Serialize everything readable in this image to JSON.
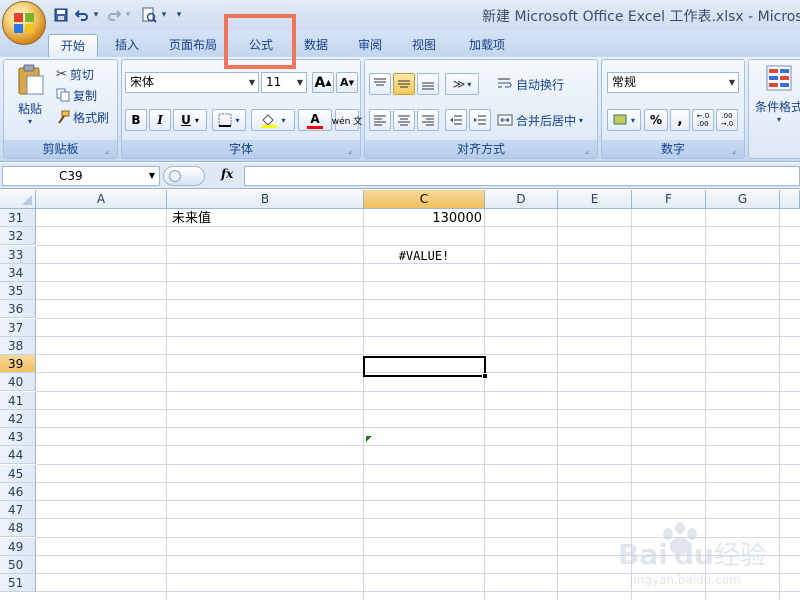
{
  "window": {
    "title": "新建 Microsoft Office Excel 工作表.xlsx - Microsoft"
  },
  "quick_access": {
    "undo_arrow": "▾",
    "redo_arrow": "▾",
    "customize_arrow": "▾"
  },
  "tabs": [
    {
      "label": "开始",
      "active": true
    },
    {
      "label": "插入"
    },
    {
      "label": "页面布局"
    },
    {
      "label": "公式",
      "highlighted": true
    },
    {
      "label": "数据"
    },
    {
      "label": "审阅"
    },
    {
      "label": "视图"
    },
    {
      "label": "加载项"
    }
  ],
  "ribbon": {
    "clipboard": {
      "label": "剪贴板",
      "paste": "粘贴",
      "cut": "剪切",
      "copy": "复制",
      "format_painter": "格式刷"
    },
    "font": {
      "label": "字体",
      "font_name": "宋体",
      "font_size": "11",
      "grow": "A",
      "shrink": "A",
      "bold": "B",
      "italic": "I",
      "underline": "U",
      "font_color": "A",
      "phonetic": "wén 文",
      "font_color_hex": "#ff0000",
      "fill_color_hex": "#ffff00"
    },
    "alignment": {
      "label": "对齐方式",
      "wrap_text": "自动换行",
      "merge_center": "合并后居中"
    },
    "number": {
      "label": "数字",
      "format": "常规",
      "percent": "%",
      "comma": ","
    },
    "styles": {
      "conditional_format": "条件格式"
    }
  },
  "formula_bar": {
    "name_box": "C39",
    "fx": "fx",
    "formula": ""
  },
  "sheet": {
    "columns": [
      "A",
      "B",
      "C",
      "D",
      "E",
      "F",
      "G"
    ],
    "selected_column": "C",
    "rows": [
      31,
      32,
      33,
      34,
      35,
      36,
      37,
      38,
      39,
      40,
      41,
      42,
      43,
      44,
      45,
      46,
      47,
      48,
      49,
      50,
      51
    ],
    "selected_row": 39,
    "cells": {
      "B31": "未来值",
      "C31": "130000",
      "C33": "#VALUE!"
    }
  },
  "watermark": {
    "brand": "Bai",
    "brand_du": "du",
    "brand_cn": "经验",
    "url": "jingyan.baidu.com"
  }
}
